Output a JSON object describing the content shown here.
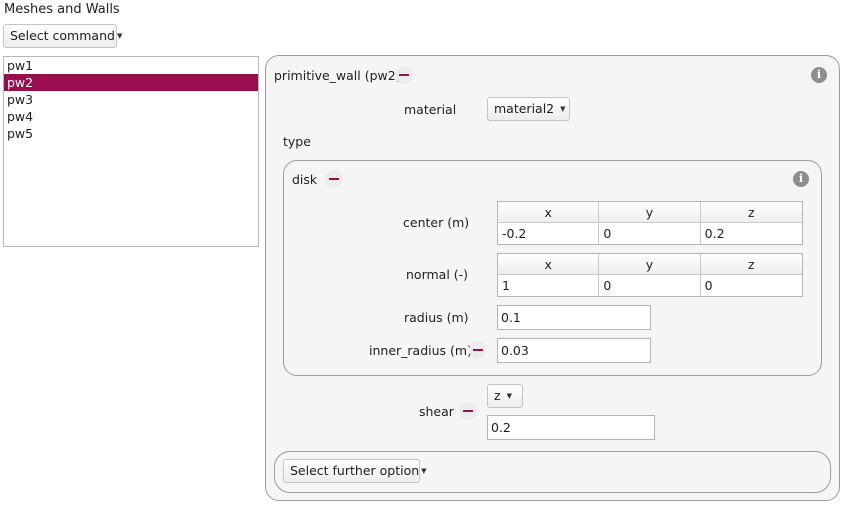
{
  "header": {
    "title": "Meshes and Walls"
  },
  "command_select": {
    "label": "Select command"
  },
  "wall_list": {
    "items": [
      "pw1",
      "pw2",
      "pw3",
      "pw4",
      "pw5"
    ],
    "selected": "pw2"
  },
  "detail": {
    "title": "primitive_wall (pw2)",
    "material": {
      "label": "material",
      "value": "material2"
    },
    "type_label": "type",
    "disk": {
      "title": "disk",
      "center": {
        "label": "center (m)",
        "headers": [
          "x",
          "y",
          "z"
        ],
        "values": [
          "-0.2",
          "0",
          "0.2"
        ]
      },
      "normal": {
        "label": "normal (-)",
        "headers": [
          "x",
          "y",
          "z"
        ],
        "values": [
          "1",
          "0",
          "0"
        ]
      },
      "radius": {
        "label": "radius (m)",
        "value": "0.1"
      },
      "inner_radius": {
        "label": "inner_radius (m)",
        "value": "0.03"
      }
    },
    "shear": {
      "label": "shear",
      "axis": "z",
      "value": "0.2"
    },
    "further_option": {
      "label": "Select further option"
    }
  },
  "colors": {
    "accent": "#9a0d4e",
    "info_icon": "#8e8e8e"
  },
  "icons": {
    "remove": "minus-icon",
    "info": "info-icon",
    "dropdown": "caret-down-icon"
  }
}
